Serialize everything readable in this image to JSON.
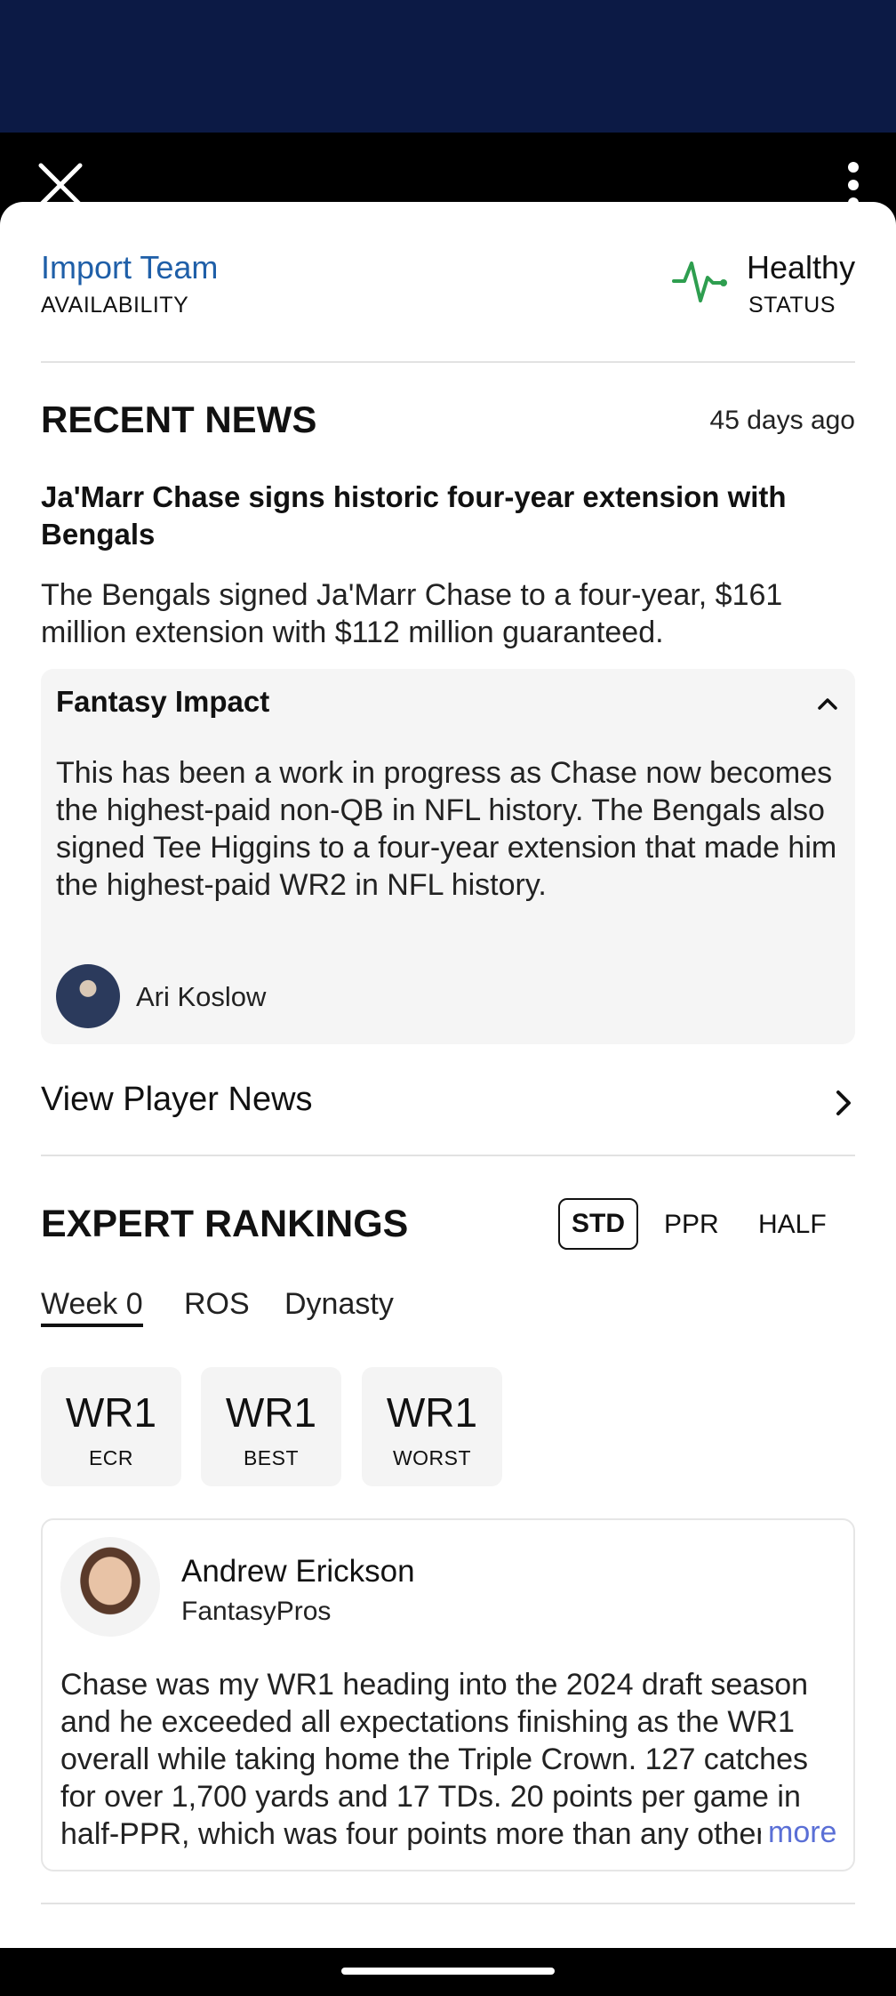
{
  "header": {
    "close_icon": "close-icon",
    "menu_icon": "more-vert-icon"
  },
  "availability": {
    "value": "Import Team",
    "label": "AVAILABILITY"
  },
  "status": {
    "value": "Healthy",
    "label": "STATUS",
    "icon": "heartbeat-icon",
    "color": "#2e9e4f"
  },
  "recent_news": {
    "title": "RECENT NEWS",
    "age": "45 days ago",
    "headline": "Ja'Marr Chase signs historic four-year extension with Bengals",
    "summary": "The Bengals signed Ja'Marr Chase to a four-year, $161 million extension with $112 million guaranteed.",
    "impact": {
      "title": "Fantasy Impact",
      "text": "This has been a work in progress as Chase now becomes the highest-paid non-QB in NFL history. The Bengals also signed Tee Higgins to a four-year extension that made him the highest-paid WR2 in NFL history.",
      "author": "Ari Koslow"
    },
    "view_all": "View Player News"
  },
  "expert_rankings": {
    "title": "EXPERT RANKINGS",
    "formats": [
      "STD",
      "PPR",
      "HALF"
    ],
    "selected_format": "STD",
    "tabs": [
      "Week 0",
      "ROS",
      "Dynasty"
    ],
    "selected_tab": "Week 0",
    "ranks": [
      {
        "value": "WR1",
        "label": "ECR"
      },
      {
        "value": "WR1",
        "label": "BEST"
      },
      {
        "value": "WR1",
        "label": "WORST"
      }
    ],
    "expert": {
      "name": "Andrew Erickson",
      "org": "FantasyPros",
      "text": "Chase was my WR1 heading into the 2024 draft season and he exceeded all expectations finishing as the WR1 overall while taking home the Triple Crown. 127 catches for over 1,700 yards and 17 TDs. 20 points per game in half-PPR, which was four points more than any other receiver.",
      "more_label": "more"
    }
  }
}
